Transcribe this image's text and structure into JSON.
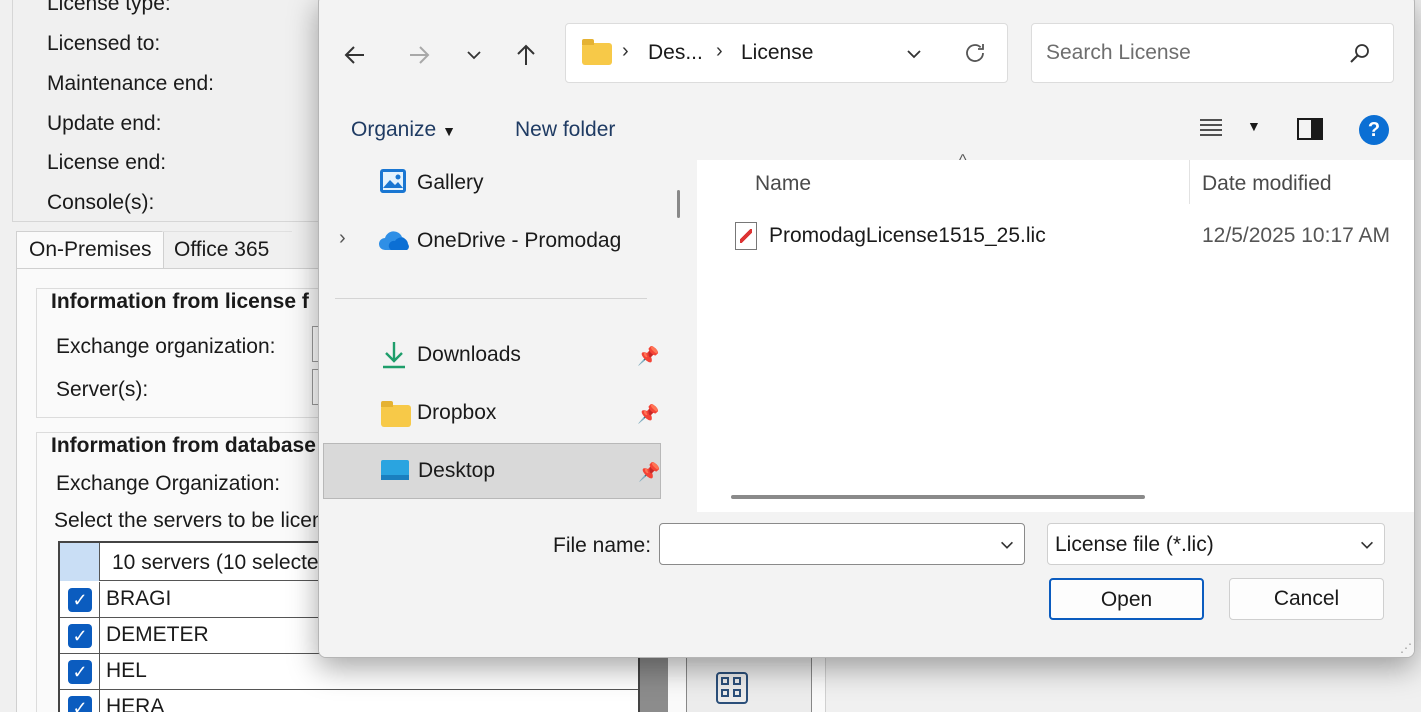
{
  "background_app": {
    "license_labels": [
      "License type:",
      "Licensed to:",
      "Maintenance end:",
      "Update end:",
      "License end:",
      "Console(s):"
    ],
    "tabs": [
      "On-Premises",
      "Office 365"
    ],
    "group_license_file": {
      "title": "Information from license f",
      "fields": [
        "Exchange organization:",
        "Server(s):"
      ]
    },
    "group_database": {
      "title": "Information from database",
      "field": "Exchange Organization:",
      "instruction": "Select the servers to be licen"
    },
    "servers_header": "10 servers (10 selected",
    "servers": [
      "BRAGI",
      "DEMETER",
      "HEL",
      "HERA"
    ]
  },
  "dialog": {
    "address": {
      "breadcrumbs": [
        "Des...",
        "License"
      ]
    },
    "search": {
      "placeholder": "Search License"
    },
    "commands": {
      "organize": "Organize",
      "new_folder": "New folder"
    },
    "nav_items": [
      {
        "label": "Gallery",
        "icon": "gallery-icon",
        "pinned": false,
        "expandable": false
      },
      {
        "label": "OneDrive - Promodag",
        "icon": "onedrive-icon",
        "pinned": false,
        "expandable": true
      },
      {
        "label": "Downloads",
        "icon": "downloads-icon",
        "pinned": true
      },
      {
        "label": "Dropbox",
        "icon": "folder-icon",
        "pinned": true
      },
      {
        "label": "Desktop",
        "icon": "desktop-icon",
        "pinned": true,
        "selected": true
      }
    ],
    "columns": {
      "name": "Name",
      "date_modified": "Date modified"
    },
    "files": [
      {
        "name": "PromodagLicense1515_25.lic",
        "date_modified": "12/5/2025 10:17 AM"
      }
    ],
    "file_name_label": "File name:",
    "file_name_value": "",
    "file_type": "License file (*.lic)",
    "buttons": {
      "open": "Open",
      "cancel": "Cancel"
    }
  }
}
